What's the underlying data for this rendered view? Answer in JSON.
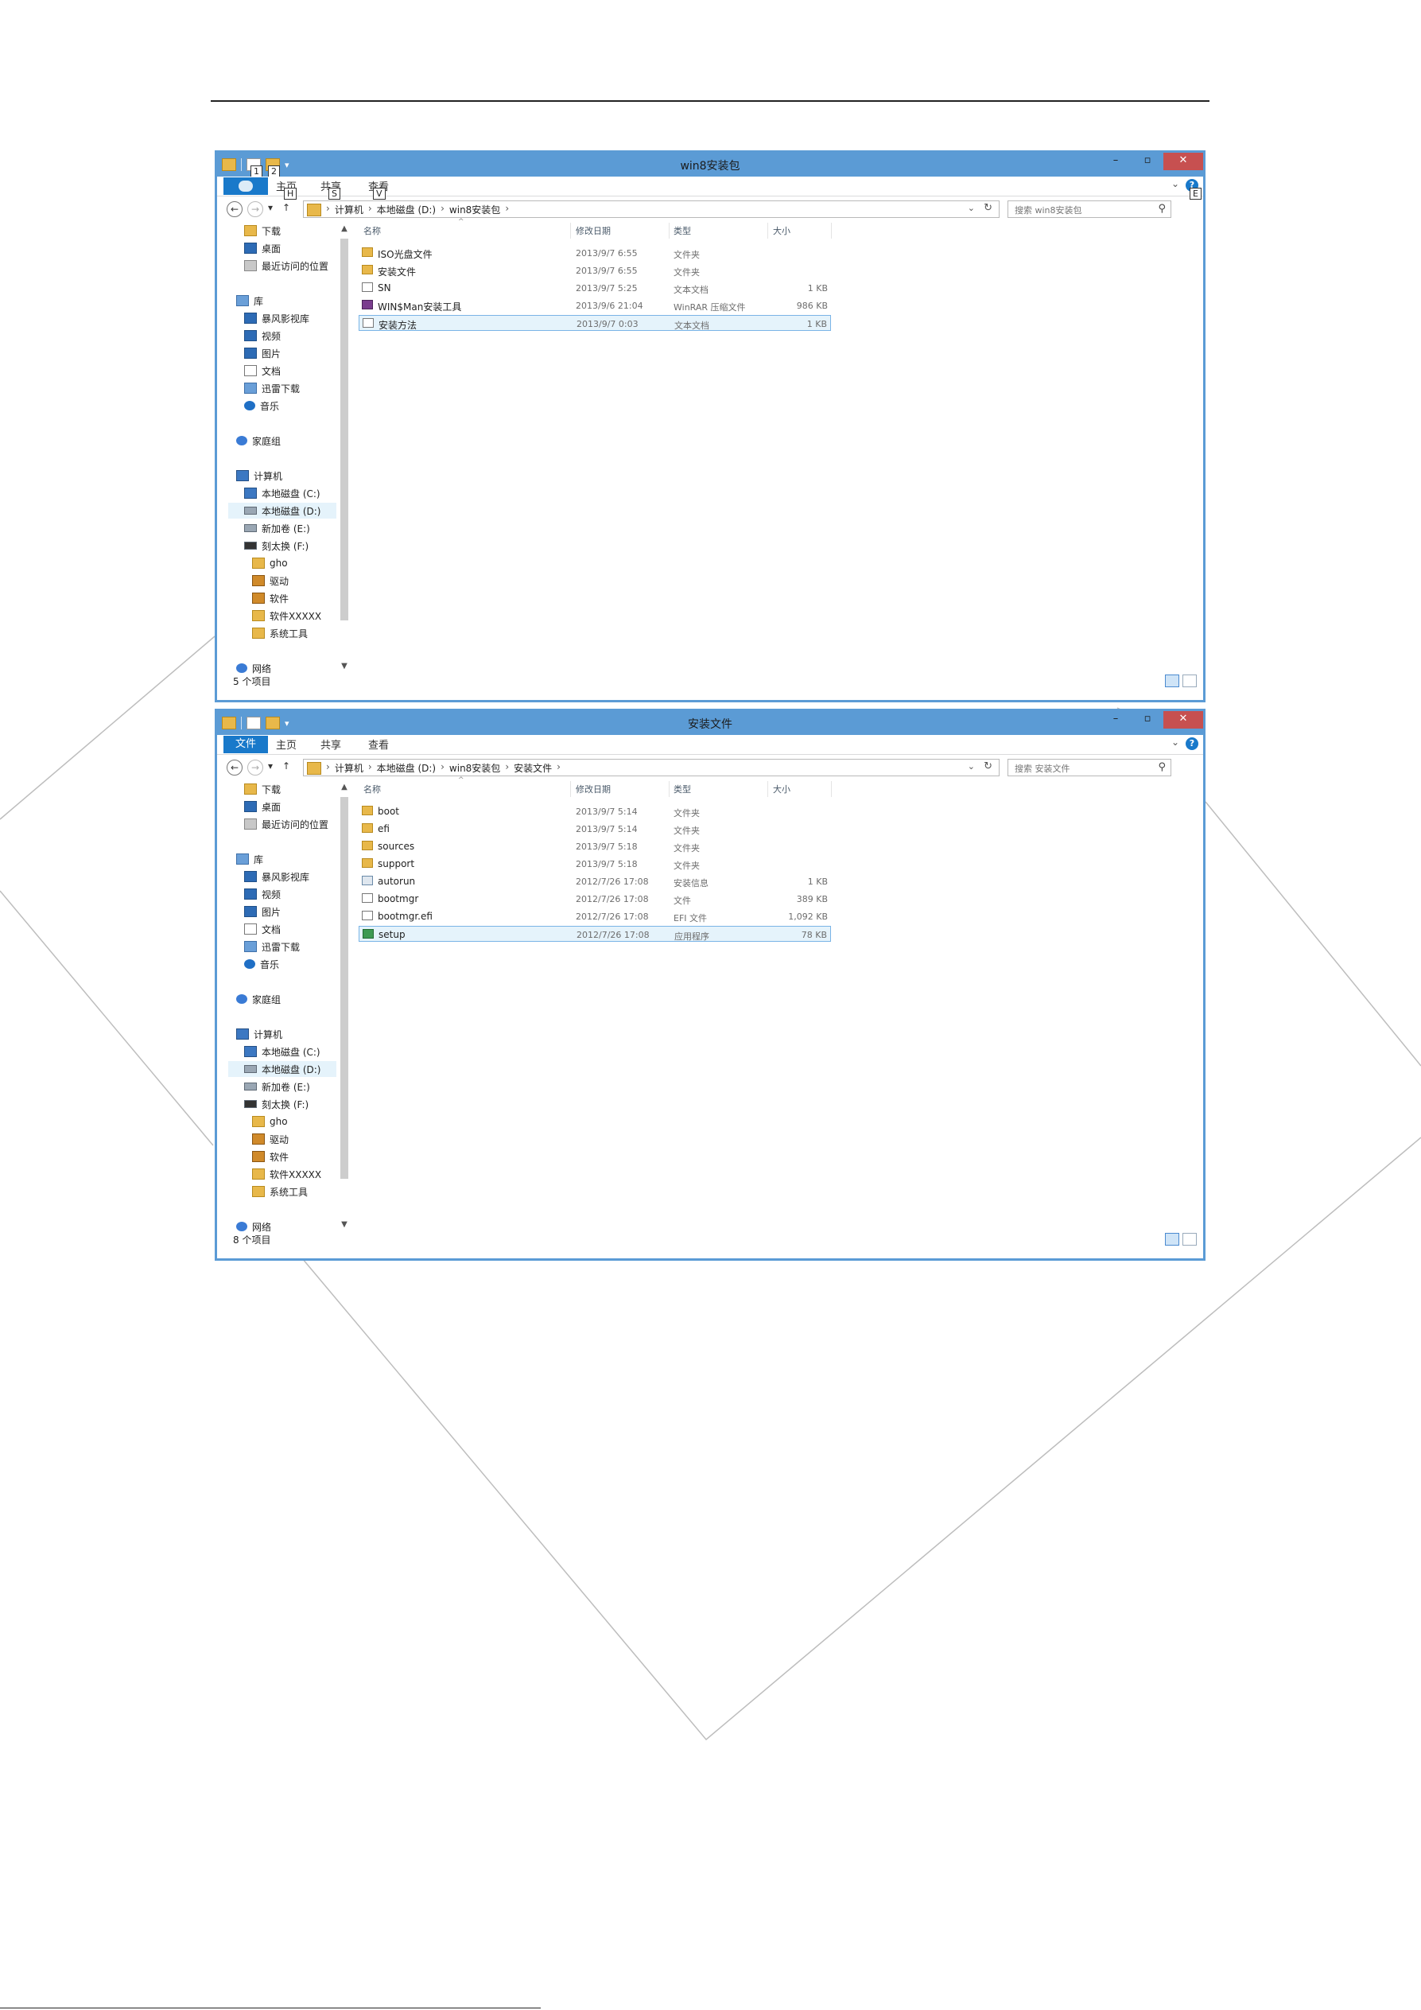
{
  "window1": {
    "title": "win8安装包",
    "keytips": [
      "1",
      "2",
      "H",
      "S",
      "V",
      "E"
    ],
    "ribbon": {
      "file_tab": "",
      "tabs": [
        "主页",
        "共享",
        "查看"
      ]
    },
    "address": {
      "crumbs": [
        "计算机",
        "本地磁盘 (D:)",
        "win8安装包"
      ]
    },
    "search_placeholder": "搜索 win8安装包",
    "columns": {
      "name": "名称",
      "date": "修改日期",
      "type": "类型",
      "size": "大小"
    },
    "rows": [
      {
        "name": "ISO光盘文件",
        "date": "2013/9/7 6:55",
        "type": "文件夹",
        "size": "",
        "icon": "folder-icon",
        "selected": false
      },
      {
        "name": "安装文件",
        "date": "2013/9/7 6:55",
        "type": "文件夹",
        "size": "",
        "icon": "folder-icon",
        "selected": false
      },
      {
        "name": "SN",
        "date": "2013/9/7 5:25",
        "type": "文本文档",
        "size": "1 KB",
        "icon": "text-file-icon",
        "selected": false
      },
      {
        "name": "WIN$Man安装工具",
        "date": "2013/9/6 21:04",
        "type": "WinRAR 压缩文件",
        "size": "986 KB",
        "icon": "rar-archive-icon",
        "selected": false
      },
      {
        "name": "安装方法",
        "date": "2013/9/7 0:03",
        "type": "文本文档",
        "size": "1 KB",
        "icon": "text-file-icon",
        "selected": true
      }
    ],
    "status": "5 个项目"
  },
  "window2": {
    "title": "安装文件",
    "ribbon": {
      "file_tab": "文件",
      "tabs": [
        "主页",
        "共享",
        "查看"
      ]
    },
    "address": {
      "crumbs": [
        "计算机",
        "本地磁盘 (D:)",
        "win8安装包",
        "安装文件"
      ]
    },
    "search_placeholder": "搜索 安装文件",
    "columns": {
      "name": "名称",
      "date": "修改日期",
      "type": "类型",
      "size": "大小"
    },
    "rows": [
      {
        "name": "boot",
        "date": "2013/9/7 5:14",
        "type": "文件夹",
        "size": "",
        "icon": "folder-icon",
        "selected": false
      },
      {
        "name": "efi",
        "date": "2013/9/7 5:14",
        "type": "文件夹",
        "size": "",
        "icon": "folder-icon",
        "selected": false
      },
      {
        "name": "sources",
        "date": "2013/9/7 5:18",
        "type": "文件夹",
        "size": "",
        "icon": "folder-icon",
        "selected": false
      },
      {
        "name": "support",
        "date": "2013/9/7 5:18",
        "type": "文件夹",
        "size": "",
        "icon": "folder-icon",
        "selected": false
      },
      {
        "name": "autorun",
        "date": "2012/7/26 17:08",
        "type": "安装信息",
        "size": "1 KB",
        "icon": "setup-info-icon",
        "selected": false
      },
      {
        "name": "bootmgr",
        "date": "2012/7/26 17:08",
        "type": "文件",
        "size": "389 KB",
        "icon": "file-icon",
        "selected": false
      },
      {
        "name": "bootmgr.efi",
        "date": "2012/7/26 17:08",
        "type": "EFI 文件",
        "size": "1,092 KB",
        "icon": "file-icon",
        "selected": false
      },
      {
        "name": "setup",
        "date": "2012/7/26 17:08",
        "type": "应用程序",
        "size": "78 KB",
        "icon": "application-icon",
        "selected": true
      }
    ],
    "status": "8 个项目"
  },
  "nav": {
    "download": "下载",
    "desktop": "桌面",
    "recent": "最近访问的位置",
    "library": "库",
    "video_lib": "暴风影视库",
    "videos": "视频",
    "pictures": "图片",
    "documents": "文档",
    "xunlei": "迅雷下载",
    "music": "音乐",
    "homegroup": "家庭组",
    "computer": "计算机",
    "drive_c": "本地磁盘 (C:)",
    "drive_d": "本地磁盘 (D:)",
    "drive_e": "新加卷 (E:)",
    "drive_f": "刻太换 (F:)",
    "gho": "gho",
    "drivers": "驱动",
    "software": "软件",
    "software_x": "软件XXXXX",
    "systools": "系统工具",
    "network": "网络"
  }
}
